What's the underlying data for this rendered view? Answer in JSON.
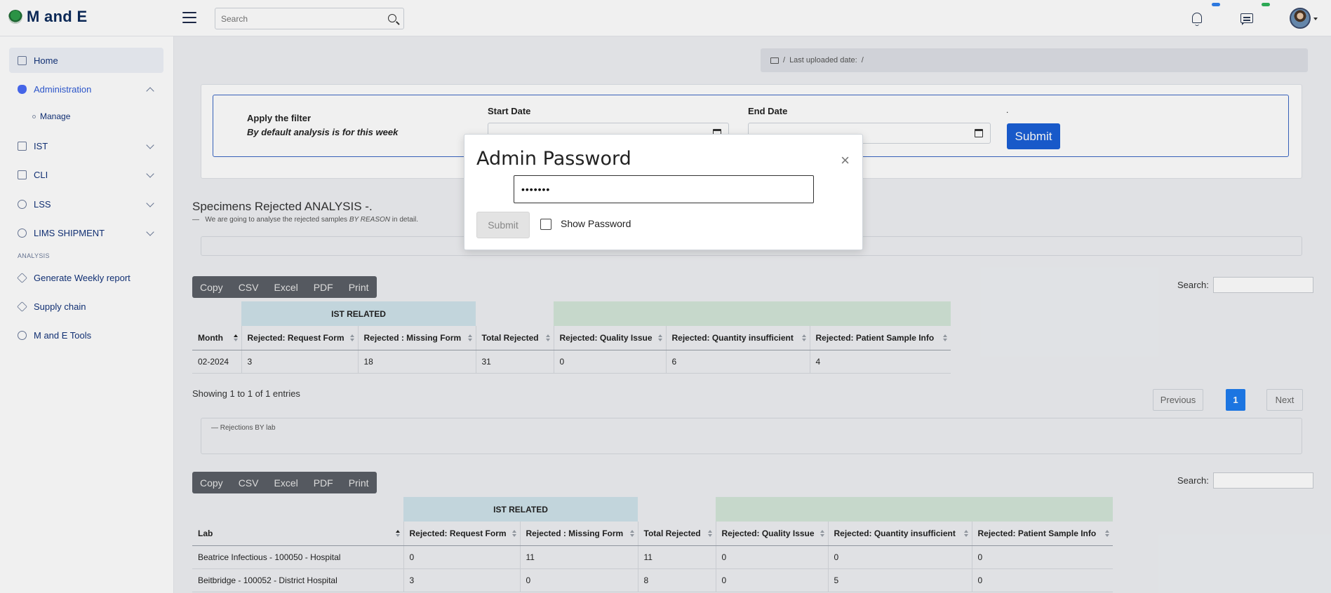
{
  "app": {
    "title": "M and E"
  },
  "header": {
    "search_placeholder": "Search"
  },
  "sidebar": {
    "items": [
      {
        "label": "Home"
      },
      {
        "label": "Administration"
      },
      {
        "label": "Manage"
      },
      {
        "label": "IST"
      },
      {
        "label": "CLI"
      },
      {
        "label": "LSS"
      },
      {
        "label": "LIMS SHIPMENT"
      },
      {
        "label": "Generate Weekly report"
      },
      {
        "label": "Supply chain"
      },
      {
        "label": "M and E Tools"
      }
    ],
    "section_label": "ANALYSIS"
  },
  "breadcrumb": {
    "sep": "/",
    "label": "Last uploaded date:"
  },
  "filter": {
    "title": "Apply the filter",
    "subtitle": "By default analysis is for this week",
    "start_label": "Start Date",
    "end_label": "End Date",
    "dot": ".",
    "submit": "Submit"
  },
  "analysis": {
    "title": "Specimens Rejected ANALYSIS -.",
    "subtitle_dash": "—",
    "subtitle_pre": "We are going to analyse the rejected samples ",
    "subtitle_em": "BY REASON",
    "subtitle_post": " in detail."
  },
  "buttons": [
    "Copy",
    "CSV",
    "Excel",
    "PDF",
    "Print"
  ],
  "search_label": "Search:",
  "table1": {
    "group_ist": "IST RELATED",
    "headers": [
      "Month",
      "Rejected: Request Form",
      "Rejected : Missing Form",
      "Total Rejected",
      "Rejected: Quality Issue",
      "Rejected: Quantity insufficient",
      "Rejected: Patient Sample Info"
    ],
    "rows": [
      [
        "02-2024",
        "3",
        "18",
        "31",
        "0",
        "6",
        "4"
      ]
    ]
  },
  "pagination": {
    "info": "Showing 1 to 1 of 1 entries",
    "previous": "Previous",
    "current": "1",
    "next": "Next"
  },
  "lab_section": {
    "label": "— Rejections BY lab"
  },
  "table2": {
    "group_ist": "IST RELATED",
    "headers": [
      "Lab",
      "Rejected: Request Form",
      "Rejected : Missing Form",
      "Total Rejected",
      "Rejected: Quality Issue",
      "Rejected: Quantity insufficient",
      "Rejected: Patient Sample Info"
    ],
    "rows": [
      [
        "Beatrice Infectious - 100050 - Hospital",
        "0",
        "11",
        "11",
        "0",
        "0",
        "0"
      ],
      [
        "Beitbridge - 100052 - District Hospital",
        "3",
        "0",
        "8",
        "0",
        "5",
        "0"
      ]
    ]
  },
  "modal": {
    "title": "Admin Password",
    "close": "×",
    "password_value": "•••••••",
    "submit": "Submit",
    "show_password": "Show Password"
  }
}
